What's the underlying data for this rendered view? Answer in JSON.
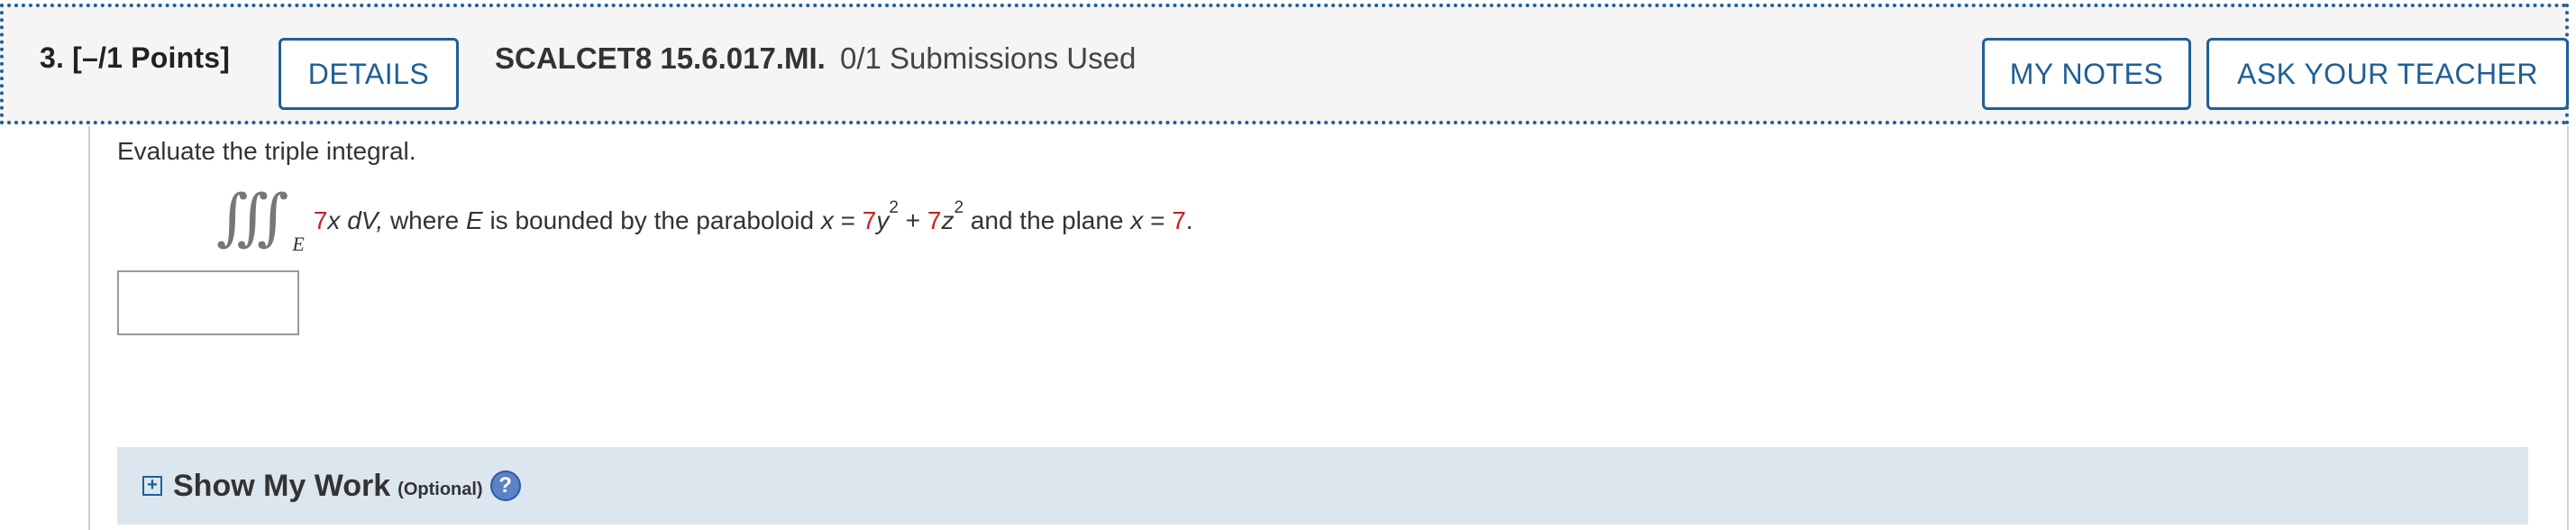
{
  "header": {
    "question_label": "3.  [–/1 Points]",
    "details_button": "DETAILS",
    "problem_code": "SCALCET8 15.6.017.MI.",
    "submissions": "0/1 Submissions Used",
    "my_notes_button": "MY NOTES",
    "ask_teacher_button": "ASK YOUR TEACHER"
  },
  "question": {
    "prompt": "Evaluate the triple integral.",
    "integral_symbol": "∭",
    "region_subscript": "E",
    "integrand_coef": "7",
    "integrand_rest": "x dV,",
    "text_where": "where",
    "var_E": "E",
    "text_bounded": "is bounded by the paraboloid",
    "var_x": "x",
    "equals": "=",
    "coef_y": "7",
    "var_y": "y",
    "exp_y": "2",
    "plus": "+",
    "coef_z": "7",
    "var_z": "z",
    "exp_z": "2",
    "text_plane": "and the plane",
    "var_x2": "x",
    "equals2": "=",
    "plane_value": "7",
    "period": "."
  },
  "answer": {
    "value": ""
  },
  "show_work": {
    "toggle_symbol": "+",
    "title": "Show My Work",
    "optional": "(Optional)",
    "help_symbol": "?"
  },
  "colors": {
    "accent": "#1f5f96",
    "randomized_value": "#cc1f1f",
    "work_bar_bg": "#dce6ef"
  }
}
